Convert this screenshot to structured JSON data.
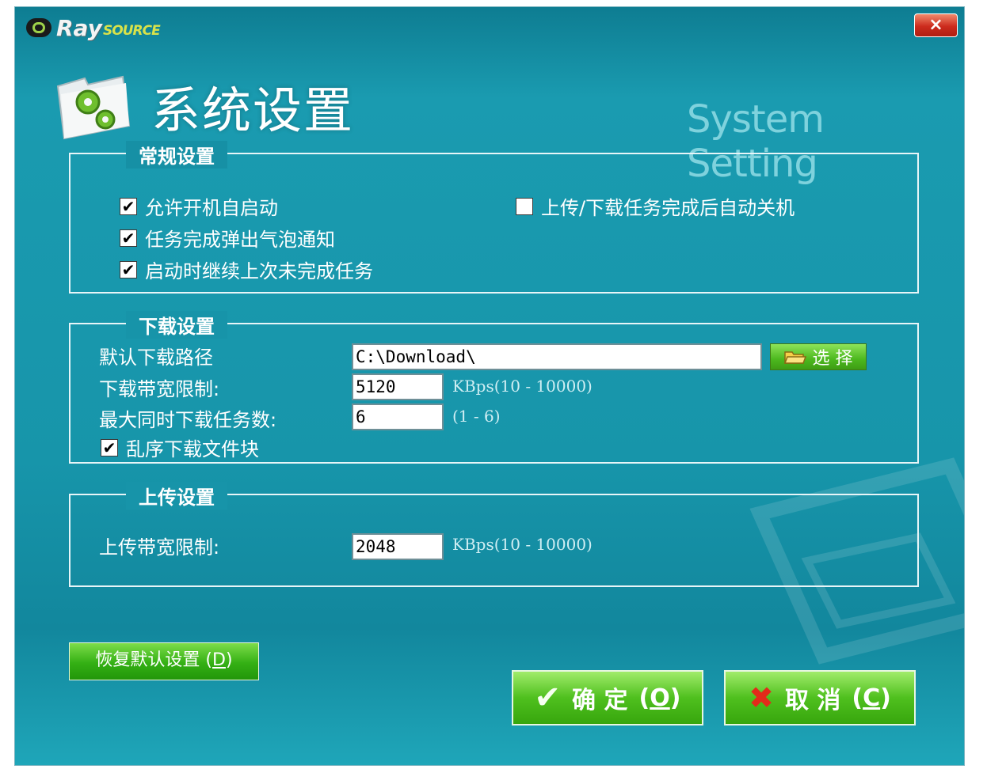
{
  "window": {
    "logo_ray": "Ray",
    "logo_source": "SOURCE",
    "close_label": "×"
  },
  "header": {
    "title_cn": "系统设置",
    "title_en": "System Setting"
  },
  "general": {
    "legend": "常规设置",
    "options": [
      {
        "label": "允许开机自启动",
        "checked": true,
        "mark": "✔"
      },
      {
        "label": "任务完成弹出气泡通知",
        "checked": true,
        "mark": "✔"
      },
      {
        "label": "启动时继续上次未完成任务",
        "checked": true,
        "mark": "✔"
      },
      {
        "label": "上传/下载任务完成后自动关机",
        "checked": false,
        "mark": ""
      }
    ]
  },
  "download": {
    "legend": "下载设置",
    "path_label": "默认下载路径",
    "path_value": "C:\\Download\\",
    "select_label": "选 择",
    "bandwidth_label": "下载带宽限制:",
    "bandwidth_value": "5120",
    "bandwidth_hint": "KBps(10 - 10000)",
    "max_tasks_label": "最大同时下载任务数:",
    "max_tasks_value": "6",
    "max_tasks_hint": "(1 - 6)",
    "random_order": {
      "label": "乱序下载文件块",
      "checked": true,
      "mark": "✔"
    }
  },
  "upload": {
    "legend": "上传设置",
    "bandwidth_label": "上传带宽限制:",
    "bandwidth_value": "2048",
    "bandwidth_hint": "KBps(10 - 10000)"
  },
  "footer": {
    "restore_label": "恢复默认设置",
    "restore_key": "D",
    "ok_label": "确 定",
    "ok_key": "O",
    "cancel_label": "取 消",
    "cancel_key": "C"
  },
  "colors": {
    "window_bg": "#1795aa",
    "button_green": "#4cb81e",
    "close_red": "#cc2b1d"
  },
  "icons": {
    "app_logo": "raysource-logo-icon",
    "settings": "gear-folder-icon",
    "select": "folder-open-icon",
    "ok": "check-icon",
    "cancel": "x-icon"
  }
}
